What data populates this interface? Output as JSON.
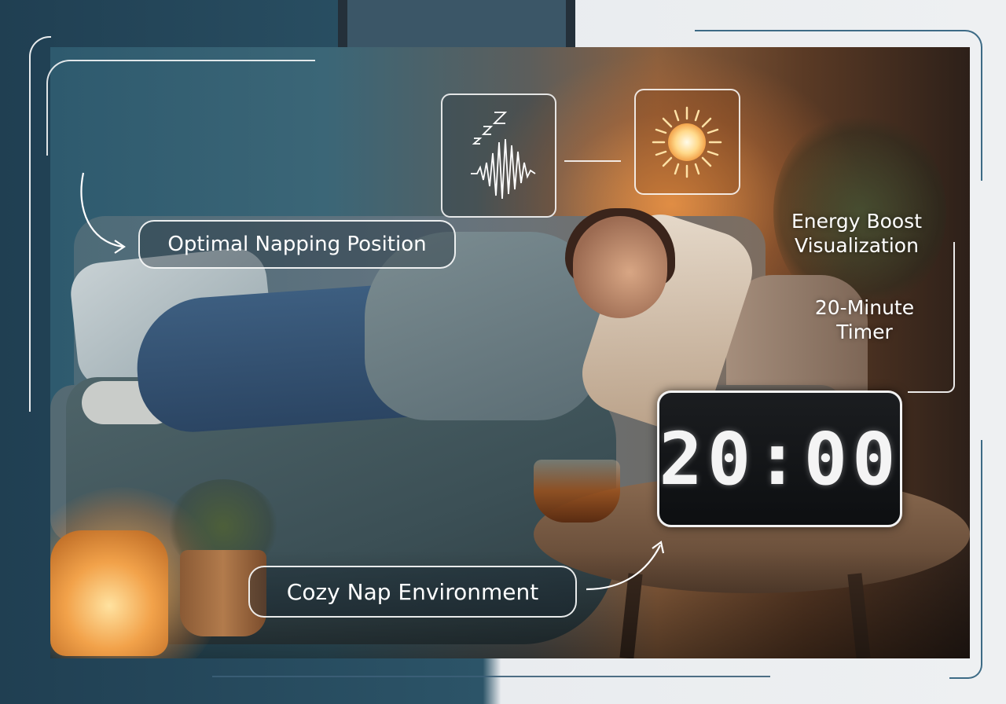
{
  "labels": {
    "position": "Optimal Napping Position",
    "environment": "Cozy Nap Environment",
    "energy_line1": "Energy Boost",
    "energy_line2": "Visualization",
    "timer_line1": "20-Minute",
    "timer_line2": "Timer"
  },
  "clock": {
    "display": "20:00"
  },
  "icons": {
    "sleep": "sleep-wave-icon",
    "energy": "sun-icon"
  },
  "colors": {
    "accent_line": "#3d6b86",
    "glow": "#f2a24a",
    "overlay": "#ffffff"
  }
}
